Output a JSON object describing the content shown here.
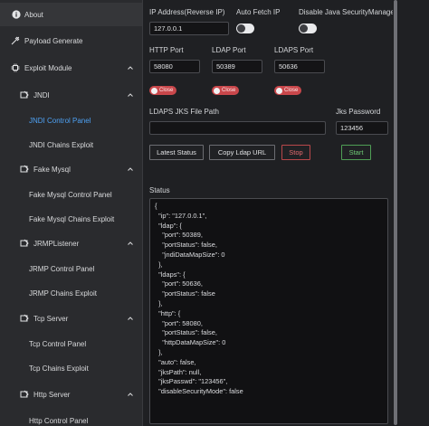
{
  "sidebar": {
    "about": "About",
    "payload_generate": "Payload Generate",
    "exploit_module": "Exploit Module",
    "jndi": "JNDI",
    "jndi_control_panel": "JNDI Control Panel",
    "jndi_chains_exploit": "JNDI Chains Exploit",
    "fake_mysql": "Fake Mysql",
    "fake_mysql_control_panel": "Fake Mysql Control Panel",
    "fake_mysql_chains_exploit": "Fake Mysql Chains Exploit",
    "jrmp_listener": "JRMPListener",
    "jrmp_control_panel": "JRMP Control Panel",
    "jrmp_chains_exploit": "JRMP Chains Exploit",
    "tcp_server": "Tcp Server",
    "tcp_control_panel": "Tcp Control Panel",
    "tcp_chains_exploit": "Tcp Chains Exploit",
    "http_server": "Http Server",
    "http_control_panel": "Http Control Panel"
  },
  "form": {
    "ip_label": "IP Address(Reverse IP)",
    "ip_value": "127.0.0.1",
    "auto_fetch_label": "Auto Fetch IP",
    "auto_fetch_on": false,
    "disable_jsm_label": "Disable Java SecurityManager",
    "disable_jsm_on": false,
    "http_port_label": "HTTP Port",
    "http_port_value": "58080",
    "ldap_port_label": "LDAP Port",
    "ldap_port_value": "50389",
    "ldaps_port_label": "LDAPS Port",
    "ldaps_port_value": "50636",
    "close_label": "Close",
    "jks_file_label": "LDAPS JKS File Path",
    "jks_file_value": "",
    "jks_password_label": "Jks Password",
    "jks_password_value": "123456"
  },
  "buttons": {
    "latest_status": "Latest Status",
    "copy_ldap_url": "Copy Ldap URL",
    "stop": "Stop",
    "start": "Start"
  },
  "status": {
    "label": "Status",
    "text": "{\n  \"ip\": \"127.0.0.1\",\n  \"ldap\": {\n    \"port\": 50389,\n    \"portStatus\": false,\n    \"jndiDataMapSize\": 0\n  },\n  \"ldaps\": {\n    \"port\": 50636,\n    \"portStatus\": false\n  },\n  \"http\": {\n    \"port\": 58080,\n    \"portStatus\": false,\n    \"httpDataMapSize\": 0\n  },\n  \"auto\": false,\n  \"jksPath\": null,\n  \"jksPasswd\": \"123456\",\n  \"disableSecurityMode\": false"
  },
  "colors": {
    "accent": "#4ea1f3",
    "close_red": "#c9474b",
    "stop_red": "#e46b6e",
    "start_green": "#6fcb75"
  }
}
